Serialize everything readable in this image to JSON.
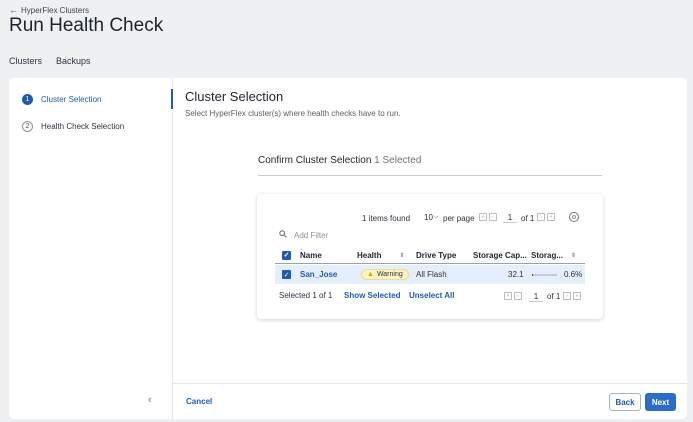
{
  "breadcrumb": {
    "arrow": "←",
    "label": "HyperFlex Clusters"
  },
  "page_title": "Run Health Check",
  "tabs": [
    {
      "label": "Clusters"
    },
    {
      "label": "Backups"
    }
  ],
  "steps": [
    {
      "number": "1",
      "label": "Cluster Selection",
      "active": true
    },
    {
      "number": "2",
      "label": "Health Check Selection",
      "active": false
    }
  ],
  "collapse_glyph": "‹",
  "main": {
    "title": "Cluster Selection",
    "description": "Select HyperFlex cluster(s) where health checks have to run."
  },
  "confirm": {
    "title": "Confirm Cluster Selection",
    "count": "1 Selected"
  },
  "table": {
    "items_found": "1 items found",
    "per_page_value": "10",
    "per_page_label": "per page",
    "page": "1",
    "of_pages": "of 1",
    "filter_placeholder": "Add Filter",
    "columns": [
      "Name",
      "Health",
      "Drive Type",
      "Storage Cap...",
      "Storag..."
    ],
    "rows": [
      {
        "name": "San_Jose",
        "health": "Warning",
        "drive_type": "All Flash",
        "storage_capacity": "32.1",
        "storage_util": "0.6%",
        "storage_util_fraction": 0.006
      }
    ],
    "selected_text": "Selected 1 of 1",
    "show_selected": "Show Selected",
    "unselect_all": "Unselect All",
    "bottom_page": "1",
    "bottom_of": "of 1"
  },
  "buttons": {
    "cancel": "Cancel",
    "back": "Back",
    "next": "Next"
  },
  "colors": {
    "accent": "#1f5bb5",
    "warning": "#fdf3c4",
    "selected_row": "#e5eefb"
  }
}
